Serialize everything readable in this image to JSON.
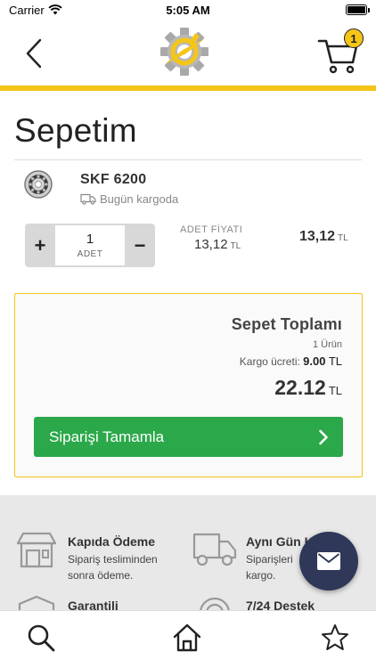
{
  "status_bar": {
    "carrier": "Carrier",
    "time": "5:05 AM"
  },
  "header": {
    "cart_count": "1"
  },
  "page": {
    "title": "Sepetim"
  },
  "cart_item": {
    "name": "SKF 6200",
    "shipping_note": "Bugün kargoda",
    "quantity": "1",
    "quantity_unit": "ADET",
    "unit_price_label": "ADET FİYATI",
    "unit_price": "13,12",
    "unit_price_currency": "TL",
    "line_total": "13,12",
    "line_total_currency": "TL"
  },
  "summary": {
    "title": "Sepet Toplamı",
    "item_count": "1 Ürün",
    "shipping_label": "Kargo ücreti:",
    "shipping_value": "9.00",
    "shipping_currency": "TL",
    "total": "22.12",
    "total_currency": "TL",
    "checkout_label": "Siparişi Tamamla"
  },
  "features": [
    {
      "title": "Kapıda Ödeme",
      "desc_line1": "Sipariş tesliminden",
      "desc_line2": "sonra ödeme."
    },
    {
      "title": "Aynı Gün K",
      "desc_line1": "Siparişleri",
      "desc_line2": "kargo."
    },
    {
      "title": "Garantili",
      "desc_line1": "",
      "desc_line2": ""
    },
    {
      "title": "7/24 Destek",
      "desc_line1": "",
      "desc_line2": ""
    }
  ],
  "colors": {
    "accent": "#f5c518",
    "checkout": "#2ba84a",
    "fab": "#2f3858"
  },
  "icons": {
    "back": "chevron-left-icon",
    "cart": "cart-icon",
    "fab": "mail-icon",
    "tabs": [
      "search-icon",
      "home-icon",
      "star-icon"
    ]
  }
}
